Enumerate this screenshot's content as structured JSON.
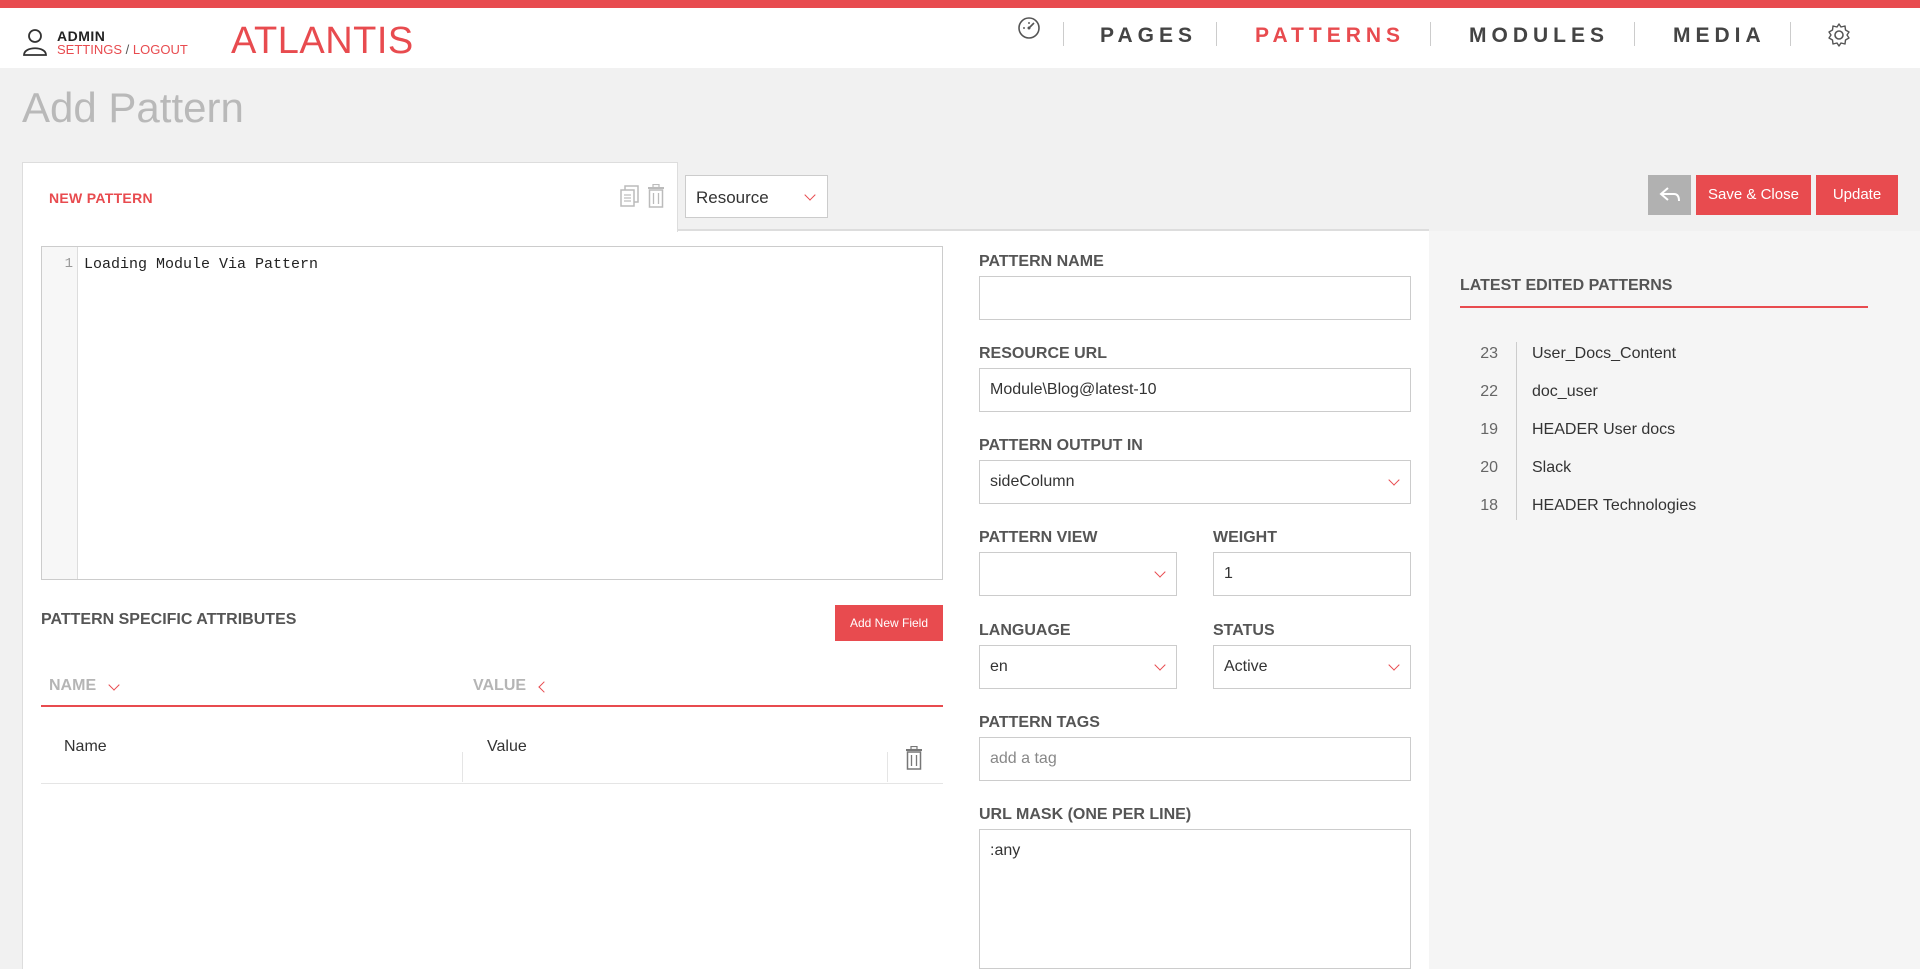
{
  "header": {
    "user": "ADMIN",
    "settings_label": "SETTINGS",
    "separator": "/",
    "logout_label": "LOGOUT",
    "brand": "ATLANTIS",
    "nav": [
      {
        "label": "PAGES",
        "active": false
      },
      {
        "label": "PATTERNS",
        "active": true
      },
      {
        "label": "MODULES",
        "active": false
      },
      {
        "label": "MEDIA",
        "active": false
      }
    ],
    "icons": [
      "user-icon",
      "dashboard-icon",
      "gear-icon"
    ]
  },
  "page": {
    "title": "Add Pattern"
  },
  "tab": {
    "label": "NEW PATTERN",
    "icons": [
      "copy-icon",
      "trash-icon"
    ]
  },
  "resource_select": {
    "value": "Resource"
  },
  "actions": {
    "save_close": "Save & Close",
    "update": "Update",
    "back_icon": "reply-icon"
  },
  "editor": {
    "line_numbers": [
      "1"
    ],
    "lines": [
      "Loading Module Via Pattern"
    ]
  },
  "attributes": {
    "title": "PATTERN SPECIFIC ATTRIBUTES",
    "add_button": "Add New Field",
    "columns": [
      "NAME",
      "VALUE"
    ],
    "rows": [
      {
        "name": "Name",
        "value": "Value"
      }
    ]
  },
  "form": {
    "pattern_name": {
      "label": "PATTERN NAME",
      "value": ""
    },
    "resource_url": {
      "label": "RESOURCE URL",
      "value": "Module\\Blog@latest-10"
    },
    "output_in": {
      "label": "PATTERN OUTPUT IN",
      "value": "sideColumn"
    },
    "view": {
      "label": "PATTERN VIEW",
      "value": ""
    },
    "weight": {
      "label": "WEIGHT",
      "value": "1"
    },
    "language": {
      "label": "LANGUAGE",
      "value": "en"
    },
    "status": {
      "label": "STATUS",
      "value": "Active"
    },
    "tags": {
      "label": "PATTERN TAGS",
      "placeholder": "add a tag"
    },
    "url_mask": {
      "label": "URL MASK (ONE PER LINE)",
      "value": ":any"
    }
  },
  "latest": {
    "title": "LATEST EDITED PATTERNS",
    "items": [
      {
        "id": "23",
        "name": "User_Docs_Content"
      },
      {
        "id": "22",
        "name": "doc_user"
      },
      {
        "id": "19",
        "name": "HEADER User docs"
      },
      {
        "id": "20",
        "name": "Slack"
      },
      {
        "id": "18",
        "name": "HEADER Technologies"
      }
    ]
  },
  "colors": {
    "accent": "#e84b4f",
    "muted_button": "#b1b1b1",
    "background": "#f1f1f1"
  }
}
